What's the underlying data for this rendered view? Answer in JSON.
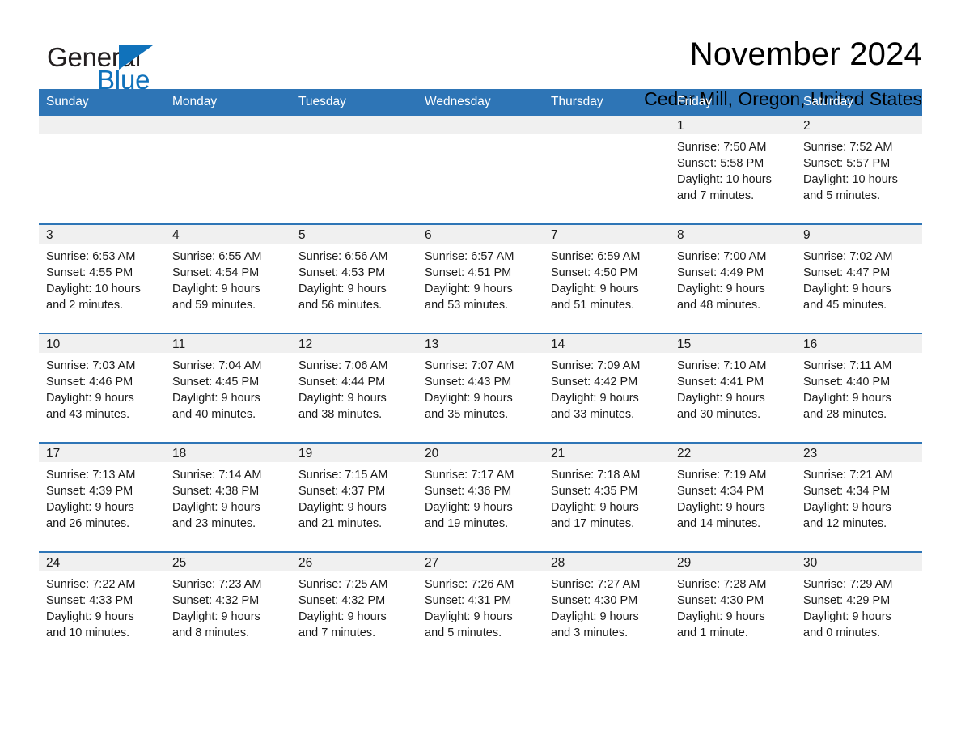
{
  "brand": {
    "name_part1": "General",
    "name_part2": "Blue",
    "logo_icon": "triangle-logo-icon"
  },
  "header": {
    "month_title": "November 2024",
    "location": "Cedar Mill, Oregon, United States"
  },
  "colors": {
    "header_blue": "#2E75B6",
    "brand_blue": "#1072BB",
    "daynum_band": "#F0F0F0",
    "text": "#1A1A1A"
  },
  "weekdays": [
    "Sunday",
    "Monday",
    "Tuesday",
    "Wednesday",
    "Thursday",
    "Friday",
    "Saturday"
  ],
  "weeks": [
    [
      {
        "day": "",
        "empty": true
      },
      {
        "day": "",
        "empty": true
      },
      {
        "day": "",
        "empty": true
      },
      {
        "day": "",
        "empty": true
      },
      {
        "day": "",
        "empty": true
      },
      {
        "day": "1",
        "sunrise": "Sunrise: 7:50 AM",
        "sunset": "Sunset: 5:58 PM",
        "daylight_line1": "Daylight: 10 hours",
        "daylight_line2": "and 7 minutes."
      },
      {
        "day": "2",
        "sunrise": "Sunrise: 7:52 AM",
        "sunset": "Sunset: 5:57 PM",
        "daylight_line1": "Daylight: 10 hours",
        "daylight_line2": "and 5 minutes."
      }
    ],
    [
      {
        "day": "3",
        "sunrise": "Sunrise: 6:53 AM",
        "sunset": "Sunset: 4:55 PM",
        "daylight_line1": "Daylight: 10 hours",
        "daylight_line2": "and 2 minutes."
      },
      {
        "day": "4",
        "sunrise": "Sunrise: 6:55 AM",
        "sunset": "Sunset: 4:54 PM",
        "daylight_line1": "Daylight: 9 hours",
        "daylight_line2": "and 59 minutes."
      },
      {
        "day": "5",
        "sunrise": "Sunrise: 6:56 AM",
        "sunset": "Sunset: 4:53 PM",
        "daylight_line1": "Daylight: 9 hours",
        "daylight_line2": "and 56 minutes."
      },
      {
        "day": "6",
        "sunrise": "Sunrise: 6:57 AM",
        "sunset": "Sunset: 4:51 PM",
        "daylight_line1": "Daylight: 9 hours",
        "daylight_line2": "and 53 minutes."
      },
      {
        "day": "7",
        "sunrise": "Sunrise: 6:59 AM",
        "sunset": "Sunset: 4:50 PM",
        "daylight_line1": "Daylight: 9 hours",
        "daylight_line2": "and 51 minutes."
      },
      {
        "day": "8",
        "sunrise": "Sunrise: 7:00 AM",
        "sunset": "Sunset: 4:49 PM",
        "daylight_line1": "Daylight: 9 hours",
        "daylight_line2": "and 48 minutes."
      },
      {
        "day": "9",
        "sunrise": "Sunrise: 7:02 AM",
        "sunset": "Sunset: 4:47 PM",
        "daylight_line1": "Daylight: 9 hours",
        "daylight_line2": "and 45 minutes."
      }
    ],
    [
      {
        "day": "10",
        "sunrise": "Sunrise: 7:03 AM",
        "sunset": "Sunset: 4:46 PM",
        "daylight_line1": "Daylight: 9 hours",
        "daylight_line2": "and 43 minutes."
      },
      {
        "day": "11",
        "sunrise": "Sunrise: 7:04 AM",
        "sunset": "Sunset: 4:45 PM",
        "daylight_line1": "Daylight: 9 hours",
        "daylight_line2": "and 40 minutes."
      },
      {
        "day": "12",
        "sunrise": "Sunrise: 7:06 AM",
        "sunset": "Sunset: 4:44 PM",
        "daylight_line1": "Daylight: 9 hours",
        "daylight_line2": "and 38 minutes."
      },
      {
        "day": "13",
        "sunrise": "Sunrise: 7:07 AM",
        "sunset": "Sunset: 4:43 PM",
        "daylight_line1": "Daylight: 9 hours",
        "daylight_line2": "and 35 minutes."
      },
      {
        "day": "14",
        "sunrise": "Sunrise: 7:09 AM",
        "sunset": "Sunset: 4:42 PM",
        "daylight_line1": "Daylight: 9 hours",
        "daylight_line2": "and 33 minutes."
      },
      {
        "day": "15",
        "sunrise": "Sunrise: 7:10 AM",
        "sunset": "Sunset: 4:41 PM",
        "daylight_line1": "Daylight: 9 hours",
        "daylight_line2": "and 30 minutes."
      },
      {
        "day": "16",
        "sunrise": "Sunrise: 7:11 AM",
        "sunset": "Sunset: 4:40 PM",
        "daylight_line1": "Daylight: 9 hours",
        "daylight_line2": "and 28 minutes."
      }
    ],
    [
      {
        "day": "17",
        "sunrise": "Sunrise: 7:13 AM",
        "sunset": "Sunset: 4:39 PM",
        "daylight_line1": "Daylight: 9 hours",
        "daylight_line2": "and 26 minutes."
      },
      {
        "day": "18",
        "sunrise": "Sunrise: 7:14 AM",
        "sunset": "Sunset: 4:38 PM",
        "daylight_line1": "Daylight: 9 hours",
        "daylight_line2": "and 23 minutes."
      },
      {
        "day": "19",
        "sunrise": "Sunrise: 7:15 AM",
        "sunset": "Sunset: 4:37 PM",
        "daylight_line1": "Daylight: 9 hours",
        "daylight_line2": "and 21 minutes."
      },
      {
        "day": "20",
        "sunrise": "Sunrise: 7:17 AM",
        "sunset": "Sunset: 4:36 PM",
        "daylight_line1": "Daylight: 9 hours",
        "daylight_line2": "and 19 minutes."
      },
      {
        "day": "21",
        "sunrise": "Sunrise: 7:18 AM",
        "sunset": "Sunset: 4:35 PM",
        "daylight_line1": "Daylight: 9 hours",
        "daylight_line2": "and 17 minutes."
      },
      {
        "day": "22",
        "sunrise": "Sunrise: 7:19 AM",
        "sunset": "Sunset: 4:34 PM",
        "daylight_line1": "Daylight: 9 hours",
        "daylight_line2": "and 14 minutes."
      },
      {
        "day": "23",
        "sunrise": "Sunrise: 7:21 AM",
        "sunset": "Sunset: 4:34 PM",
        "daylight_line1": "Daylight: 9 hours",
        "daylight_line2": "and 12 minutes."
      }
    ],
    [
      {
        "day": "24",
        "sunrise": "Sunrise: 7:22 AM",
        "sunset": "Sunset: 4:33 PM",
        "daylight_line1": "Daylight: 9 hours",
        "daylight_line2": "and 10 minutes."
      },
      {
        "day": "25",
        "sunrise": "Sunrise: 7:23 AM",
        "sunset": "Sunset: 4:32 PM",
        "daylight_line1": "Daylight: 9 hours",
        "daylight_line2": "and 8 minutes."
      },
      {
        "day": "26",
        "sunrise": "Sunrise: 7:25 AM",
        "sunset": "Sunset: 4:32 PM",
        "daylight_line1": "Daylight: 9 hours",
        "daylight_line2": "and 7 minutes."
      },
      {
        "day": "27",
        "sunrise": "Sunrise: 7:26 AM",
        "sunset": "Sunset: 4:31 PM",
        "daylight_line1": "Daylight: 9 hours",
        "daylight_line2": "and 5 minutes."
      },
      {
        "day": "28",
        "sunrise": "Sunrise: 7:27 AM",
        "sunset": "Sunset: 4:30 PM",
        "daylight_line1": "Daylight: 9 hours",
        "daylight_line2": "and 3 minutes."
      },
      {
        "day": "29",
        "sunrise": "Sunrise: 7:28 AM",
        "sunset": "Sunset: 4:30 PM",
        "daylight_line1": "Daylight: 9 hours",
        "daylight_line2": "and 1 minute."
      },
      {
        "day": "30",
        "sunrise": "Sunrise: 7:29 AM",
        "sunset": "Sunset: 4:29 PM",
        "daylight_line1": "Daylight: 9 hours",
        "daylight_line2": "and 0 minutes."
      }
    ]
  ]
}
